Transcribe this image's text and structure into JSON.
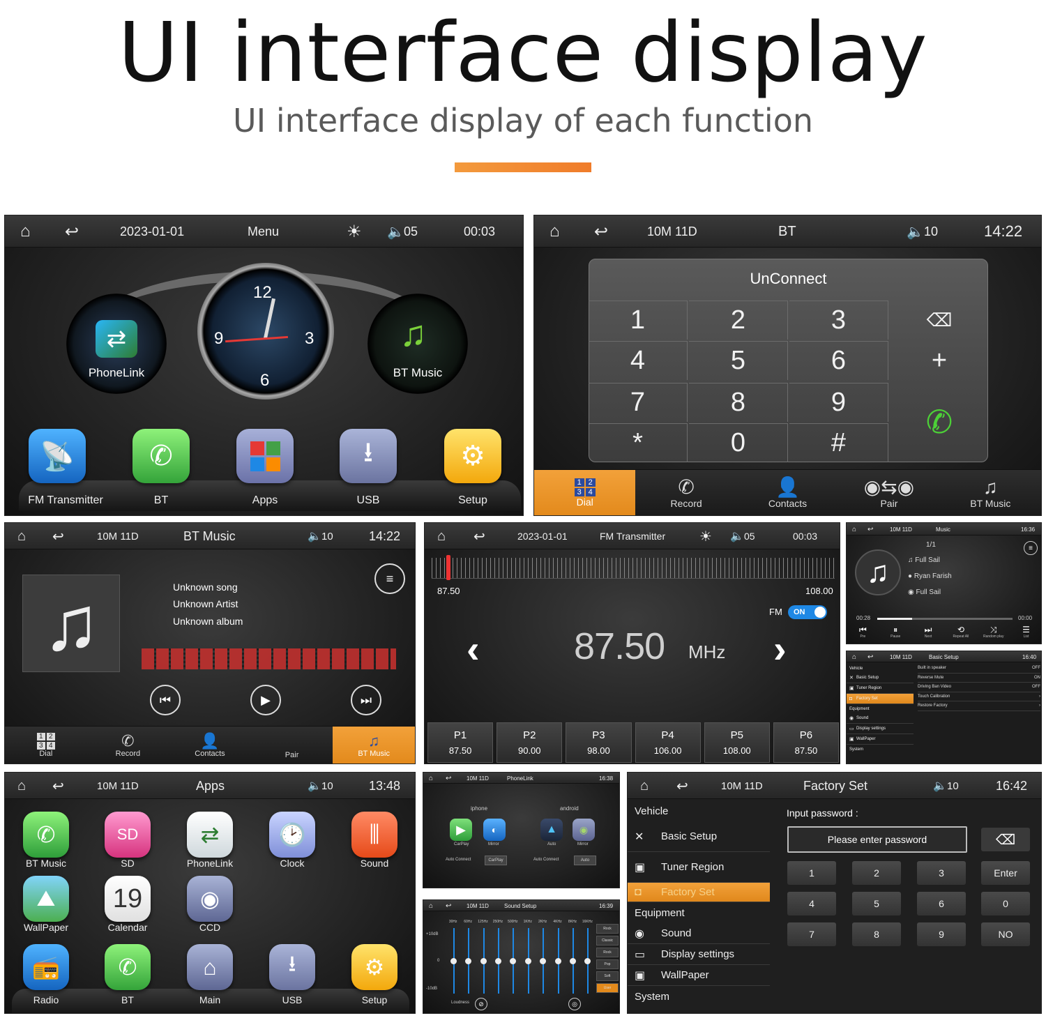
{
  "header": {
    "title": "UI interface display",
    "subtitle": "UI interface display of each function"
  },
  "menu": {
    "date": "2023-01-01",
    "title": "Menu",
    "volume": "05",
    "time": "00:03",
    "left_knob": "PhoneLink",
    "right_knob": "BT Music",
    "clock_nums": [
      "12",
      "3",
      "6",
      "9"
    ],
    "apps": [
      "FM Transmitter",
      "BT",
      "Apps",
      "USB",
      "Setup"
    ]
  },
  "bt": {
    "date": "10M 11D",
    "title": "BT",
    "volume": "10",
    "time": "14:22",
    "status": "UnConnect",
    "keys": [
      "1",
      "2",
      "3",
      "4",
      "5",
      "6",
      "7",
      "8",
      "9",
      "*",
      "0",
      "#"
    ],
    "tabs": [
      "Dial",
      "Record",
      "Contacts",
      "Pair",
      "BT Music"
    ],
    "dial_grid": [
      "1",
      "2",
      "3",
      "4"
    ]
  },
  "btmusic": {
    "date": "10M 11D",
    "title": "BT Music",
    "volume": "10",
    "time": "14:22",
    "song": "Unknown song",
    "artist": "Unknown Artist",
    "album": "Unknown album",
    "tabs": [
      "Dial",
      "Record",
      "Contacts",
      "Pair",
      "BT Music"
    ],
    "dial_grid": [
      "1",
      "2",
      "3",
      "4"
    ]
  },
  "fm": {
    "date": "2023-01-01",
    "title": "FM Transmitter",
    "volume": "05",
    "time": "00:03",
    "min": "87.50",
    "max": "108.00",
    "fm_label": "FM",
    "toggle": "ON",
    "freq": "87.50",
    "unit": "MHz",
    "presets": [
      {
        "p": "P1",
        "f": "87.50"
      },
      {
        "p": "P2",
        "f": "90.00"
      },
      {
        "p": "P3",
        "f": "98.00"
      },
      {
        "p": "P4",
        "f": "106.00"
      },
      {
        "p": "P5",
        "f": "108.00"
      },
      {
        "p": "P6",
        "f": "87.50"
      }
    ]
  },
  "music_small": {
    "date": "10M 11D",
    "title": "Music",
    "time": "16:36",
    "count": "1/1",
    "song": "Full Sail",
    "artist": "Ryan Farish",
    "album": "Full Sail",
    "elapsed": "00:28",
    "total": "00:00",
    "progress_fraction": 0.26,
    "controls": [
      "Pre",
      "Pause",
      "Next",
      "Repeat All",
      "Random play",
      "List"
    ]
  },
  "setup_small": {
    "date": "10M 11D",
    "title": "Basic Setup",
    "time": "16:40",
    "side": [
      "Vehicle",
      "Basic Setup",
      "Tuner Region",
      "Factory Set",
      "Equipment",
      "Sound",
      "Display settings",
      "WallPaper",
      "System"
    ],
    "rows": [
      {
        "k": "Built in speaker",
        "v": "OFF"
      },
      {
        "k": "Reverse Mute",
        "v": "ON"
      },
      {
        "k": "Driving Ban Video",
        "v": "OFF"
      },
      {
        "k": "Touch Calibration",
        "v": "›"
      },
      {
        "k": "Restore Factory",
        "v": "›"
      }
    ]
  },
  "apps": {
    "date": "10M 11D",
    "title": "Apps",
    "volume": "10",
    "time": "13:48",
    "row1": [
      "BT Music",
      "SD",
      "PhoneLink",
      "Clock",
      "Sound"
    ],
    "row2": [
      "WallPaper",
      "Calendar",
      "CCD"
    ],
    "row3": [
      "Radio",
      "BT",
      "Main",
      "USB",
      "Setup"
    ],
    "cal_num": "19"
  },
  "phonelink_small": {
    "date": "10M 11D",
    "title": "PhoneLink",
    "time": "16:38",
    "ios": "iphone",
    "android": "android",
    "items": [
      "CarPlay",
      "Mirror",
      "Auto",
      "Mirror"
    ],
    "auto1": "Auto Connect",
    "opt1": "CarPlay",
    "auto2": "Auto Connect",
    "opt2": "Auto"
  },
  "sound_small": {
    "date": "10M 11D",
    "title": "Sound Setup",
    "time": "16:39",
    "top": "+10dB",
    "mid": "0",
    "bot": "-10dB",
    "bands": [
      "30Hz",
      "60Hz",
      "125Hz",
      "250Hz",
      "500Hz",
      "1KHz",
      "2KHz",
      "4KHz",
      "8KHz",
      "16KHz"
    ],
    "presets": [
      "Rock",
      "Classic",
      "Rock",
      "Pop",
      "Soft",
      "User"
    ],
    "loud": "Loudness"
  },
  "factory": {
    "date": "10M 11D",
    "title": "Factory Set",
    "volume": "10",
    "time": "16:42",
    "side": [
      "Vehicle",
      "Basic Setup",
      "Tuner Region",
      "Factory Set",
      "Equipment",
      "Sound",
      "Display settings",
      "WallPaper",
      "System"
    ],
    "input_label": "Input password :",
    "placeholder": "Please enter password",
    "keys": [
      "1",
      "2",
      "3",
      "Enter",
      "4",
      "5",
      "6",
      "0",
      "7",
      "8",
      "9",
      "NO"
    ]
  }
}
